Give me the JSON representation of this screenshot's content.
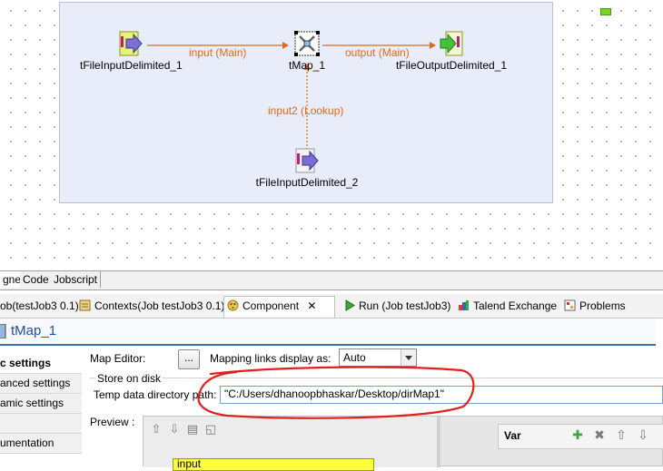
{
  "designer": {
    "components": [
      {
        "id": "in1",
        "label": "tFileInputDelimited_1"
      },
      {
        "id": "map",
        "label": "tMap_1"
      },
      {
        "id": "out",
        "label": "tFileOutputDelimited_1"
      },
      {
        "id": "in2",
        "label": "tFileInputDelimited_2"
      }
    ],
    "links": {
      "input_main": "input (Main)",
      "output_main": "output (Main)",
      "input2_lookup": "input2 (Lookup)"
    }
  },
  "editor_tabs": [
    "gner",
    "Code",
    "Jobscript"
  ],
  "view_tabs": [
    {
      "label": "ob(testJob3 0.1)"
    },
    {
      "label": "Contexts(Job testJob3 0.1)"
    },
    {
      "label": "Component"
    },
    {
      "label": "Run (Job testJob3)"
    },
    {
      "label": "Talend Exchange"
    },
    {
      "label": "Problems"
    }
  ],
  "component_title": "tMap_1",
  "side_tabs": [
    "c settings",
    "anced settings",
    "amic settings",
    "",
    "umentation"
  ],
  "settings": {
    "map_editor_label": "Map Editor:",
    "map_editor_button": "...",
    "mapping_links_label": "Mapping links display as:",
    "mapping_links_value": "Auto",
    "store_on_disk_label": "Store on disk",
    "temp_dir_label": "Temp data directory path:",
    "temp_dir_value": "\"C:/Users/dhanoopbhaskar/Desktop/dirMap1\"",
    "preview_label": "Preview :"
  },
  "preview": {
    "input_table": "input",
    "var_label": "Var"
  },
  "colors": {
    "link_label": "#d96d1a",
    "annotation": "#e0201c",
    "title_accent": "#1c4fa0"
  }
}
